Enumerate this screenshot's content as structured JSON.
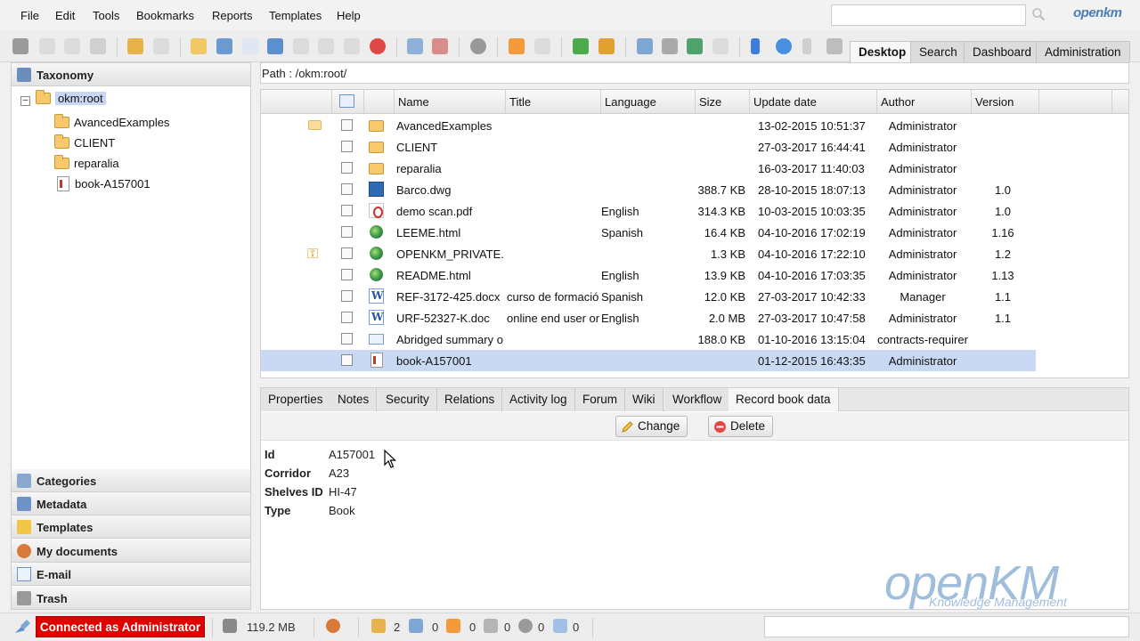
{
  "menu": [
    "File",
    "Edit",
    "Tools",
    "Bookmarks",
    "Reports",
    "Templates",
    "Help"
  ],
  "logo_small": "openkm",
  "main_tabs": [
    "Desktop",
    "Search",
    "Dashboard",
    "Administration"
  ],
  "left": {
    "taxonomy": "Taxonomy",
    "tree": {
      "root": "okm:root",
      "children": [
        "AvancedExamples",
        "CLIENT",
        "reparalia",
        "book-A157001"
      ]
    },
    "stacks": [
      "Categories",
      "Metadata",
      "Templates",
      "My documents",
      "E-mail",
      "Trash"
    ]
  },
  "path": "Path : /okm:root/",
  "grid": {
    "columns": [
      "Name",
      "Title",
      "Language",
      "Size",
      "Update date",
      "Author",
      "Version"
    ],
    "rows": [
      {
        "icon": "folder",
        "state": "folder",
        "name": "AvancedExamples",
        "title": "",
        "language": "",
        "size": "",
        "date": "13-02-2015 10:51:37",
        "author": "Administrator",
        "version": ""
      },
      {
        "icon": "folder",
        "state": "",
        "name": "CLIENT",
        "title": "",
        "language": "",
        "size": "",
        "date": "27-03-2017 16:44:41",
        "author": "Administrator",
        "version": ""
      },
      {
        "icon": "folder",
        "state": "",
        "name": "reparalia",
        "title": "",
        "language": "",
        "size": "",
        "date": "16-03-2017 11:40:03",
        "author": "Administrator",
        "version": ""
      },
      {
        "icon": "dwg",
        "state": "",
        "name": "Barco.dwg",
        "title": "",
        "language": "",
        "size": "388.7 KB",
        "date": "28-10-2015 18:07:13",
        "author": "Administrator",
        "version": "1.0"
      },
      {
        "icon": "pdf",
        "state": "",
        "name": "demo scan.pdf",
        "title": "",
        "language": "English",
        "size": "314.3 KB",
        "date": "10-03-2015 10:03:35",
        "author": "Administrator",
        "version": "1.0"
      },
      {
        "icon": "html",
        "state": "",
        "name": "LEEME.html",
        "title": "",
        "language": "Spanish",
        "size": "16.4 KB",
        "date": "04-10-2016 17:02:19",
        "author": "Administrator",
        "version": "1.16"
      },
      {
        "icon": "html",
        "state": "key",
        "name": "OPENKM_PRIVATE.",
        "title": "",
        "language": "",
        "size": "1.3 KB",
        "date": "04-10-2016 17:22:10",
        "author": "Administrator",
        "version": "1.2"
      },
      {
        "icon": "html",
        "state": "",
        "name": "README.html",
        "title": "",
        "language": "English",
        "size": "13.9 KB",
        "date": "04-10-2016 17:03:35",
        "author": "Administrator",
        "version": "1.13"
      },
      {
        "icon": "word",
        "state": "",
        "name": "REF-3172-425.docx",
        "title": "curso de formació",
        "language": "Spanish",
        "size": "12.0 KB",
        "date": "27-03-2017 10:42:33",
        "author": "Manager",
        "version": "1.1"
      },
      {
        "icon": "word",
        "state": "",
        "name": "URF-52327-K.doc",
        "title": "online end user or",
        "language": "English",
        "size": "2.0 MB",
        "date": "27-03-2017 10:47:58",
        "author": "Administrator",
        "version": "1.1"
      },
      {
        "icon": "mail",
        "state": "",
        "name": "Abridged summary o",
        "title": "",
        "language": "",
        "size": "188.0 KB",
        "date": "01-10-2016 13:15:04",
        "author": "contracts-requirer",
        "version": ""
      },
      {
        "icon": "book",
        "state": "",
        "name": "book-A157001",
        "title": "",
        "language": "",
        "size": "",
        "date": "01-12-2015 16:43:35",
        "author": "Administrator",
        "version": "",
        "selected": true
      }
    ]
  },
  "bottom_tabs": [
    "Properties",
    "Notes",
    "Security",
    "Relations",
    "Activity log",
    "Forum",
    "Wiki",
    "Workflow",
    "Record book data"
  ],
  "actions": {
    "change": "Change",
    "delete": "Delete"
  },
  "record": [
    {
      "label": "Id",
      "value": "A157001"
    },
    {
      "label": "Corridor",
      "value": "A23"
    },
    {
      "label": "Shelves ID",
      "value": "HI-47"
    },
    {
      "label": "Type",
      "value": "Book"
    }
  ],
  "watermark": {
    "main": "openKM",
    "sub": "Knowledge Management"
  },
  "status": {
    "connected": "Connected as Administrator",
    "size": "119.2 MB",
    "counters": [
      "2",
      "0",
      "0",
      "0",
      "0",
      "0"
    ]
  },
  "colors": {
    "accent": "#4a7fb5",
    "selected_row": "#c9d9f4",
    "connected_bg": "#e00000"
  }
}
